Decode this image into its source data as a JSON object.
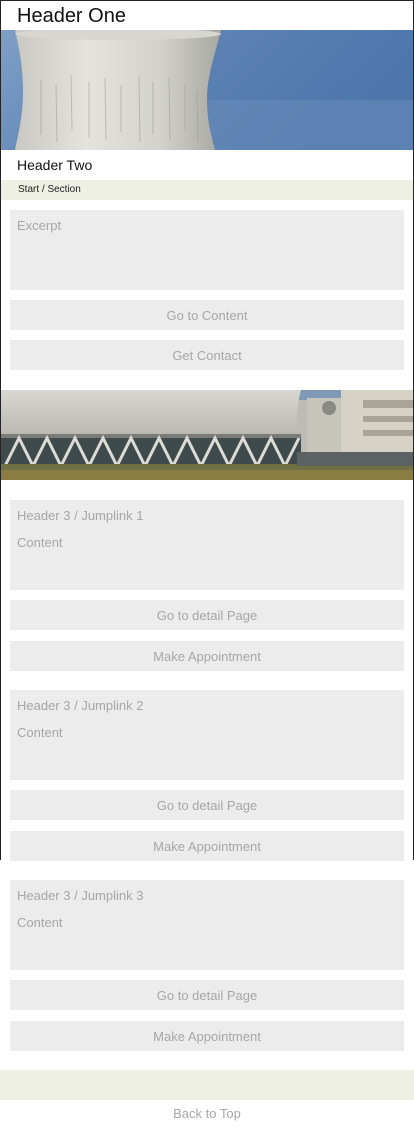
{
  "header": {
    "title": "Header One",
    "subtitle": "Header Two"
  },
  "breadcrumb": "Start / Section",
  "intro": {
    "excerpt": "Excerpt",
    "go_to_content": "Go to Content",
    "get_contact": "Get Contact"
  },
  "sections": [
    {
      "title": "Header 3 / Jumplink 1",
      "content": "Content",
      "detail_button": "Go to detail Page",
      "appointment_button": "Make Appointment"
    },
    {
      "title": "Header 3 / Jumplink 2",
      "content": "Content",
      "detail_button": "Go to detail Page",
      "appointment_button": "Make Appointment"
    },
    {
      "title": "Header 3 / Jumplink 3",
      "content": "Content",
      "detail_button": "Go to detail Page",
      "appointment_button": "Make Appointment"
    }
  ],
  "footer": {
    "back_to_top": "Back to Top"
  },
  "colors": {
    "placeholder_gray": "#ececec",
    "accent_bar": "#eef0e4",
    "sky": "#5f84b4"
  }
}
